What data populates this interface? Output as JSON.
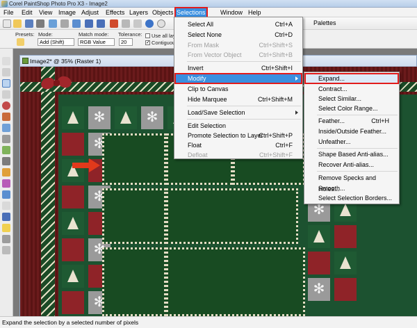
{
  "window": {
    "title": "Corel PaintShop Photo Pro X3 - Image2"
  },
  "menubar": {
    "items": [
      "File",
      "Edit",
      "View",
      "Image",
      "Adjust",
      "Effects",
      "Layers",
      "Objects",
      "Selections",
      "Window",
      "Help"
    ],
    "active": "Selections"
  },
  "toolbar": {
    "palettes_label": "Palettes"
  },
  "options": {
    "presets_label": "Presets:",
    "mode_label": "Mode:",
    "mode_value": "Add (Shift)",
    "match_mode_label": "Match mode:",
    "match_mode_value": "RGB Value",
    "tolerance_label": "Tolerance:",
    "tolerance_value": "20",
    "use_all_layers": "Use all lay",
    "contiguous": "Contiguous"
  },
  "document": {
    "title": "Image2* @ 35% (Raster 1)"
  },
  "selections_menu": {
    "items": [
      {
        "label": "Select All",
        "shortcut": "Ctrl+A",
        "disabled": false
      },
      {
        "label": "Select None",
        "shortcut": "Ctrl+D",
        "disabled": false
      },
      {
        "label": "From Mask",
        "shortcut": "Ctrl+Shift+S",
        "disabled": true
      },
      {
        "label": "From Vector Object",
        "shortcut": "Ctrl+Shift+B",
        "disabled": true
      },
      {
        "label": "Invert",
        "shortcut": "Ctrl+Shift+I",
        "disabled": false
      },
      {
        "label": "Modify",
        "shortcut": "",
        "disabled": false
      },
      {
        "label": "Clip to Canvas",
        "shortcut": "",
        "disabled": false
      },
      {
        "label": "Hide Marquee",
        "shortcut": "Ctrl+Shift+M",
        "disabled": false
      },
      {
        "label": "Load/Save Selection",
        "shortcut": "",
        "disabled": false
      },
      {
        "label": "Edit Selection",
        "shortcut": "",
        "disabled": false
      },
      {
        "label": "Promote Selection to Layer",
        "shortcut": "Ctrl+Shift+P",
        "disabled": false
      },
      {
        "label": "Float",
        "shortcut": "Ctrl+F",
        "disabled": false
      },
      {
        "label": "Defloat",
        "shortcut": "Ctrl+Shift+F",
        "disabled": true
      }
    ]
  },
  "modify_submenu": {
    "items": [
      {
        "label": "Expand...",
        "shortcut": ""
      },
      {
        "label": "Contract...",
        "shortcut": ""
      },
      {
        "label": "Select Similar...",
        "shortcut": ""
      },
      {
        "label": "Select Color Range...",
        "shortcut": ""
      },
      {
        "label": "Feather...",
        "shortcut": "Ctrl+H"
      },
      {
        "label": "Inside/Outside Feather...",
        "shortcut": ""
      },
      {
        "label": "Unfeather...",
        "shortcut": ""
      },
      {
        "label": "Shape Based Anti-alias...",
        "shortcut": ""
      },
      {
        "label": "Recover Anti-alias...",
        "shortcut": ""
      },
      {
        "label": "Remove Specks and Holes...",
        "shortcut": ""
      },
      {
        "label": "Smooth...",
        "shortcut": ""
      },
      {
        "label": "Select Selection Borders...",
        "shortcut": ""
      }
    ]
  },
  "statusbar": {
    "text": "Expand the selection by a selected number of pixels"
  },
  "colors": {
    "highlight": "#3a8fe0",
    "annotation_red": "#e21b1b",
    "paper_green": "#1e5a2c",
    "paper_red": "#8f2328"
  },
  "icons": [
    "pan-icon",
    "zoom-icon",
    "selection-icon",
    "brush-icon",
    "text-icon",
    "arrow-annotation"
  ]
}
